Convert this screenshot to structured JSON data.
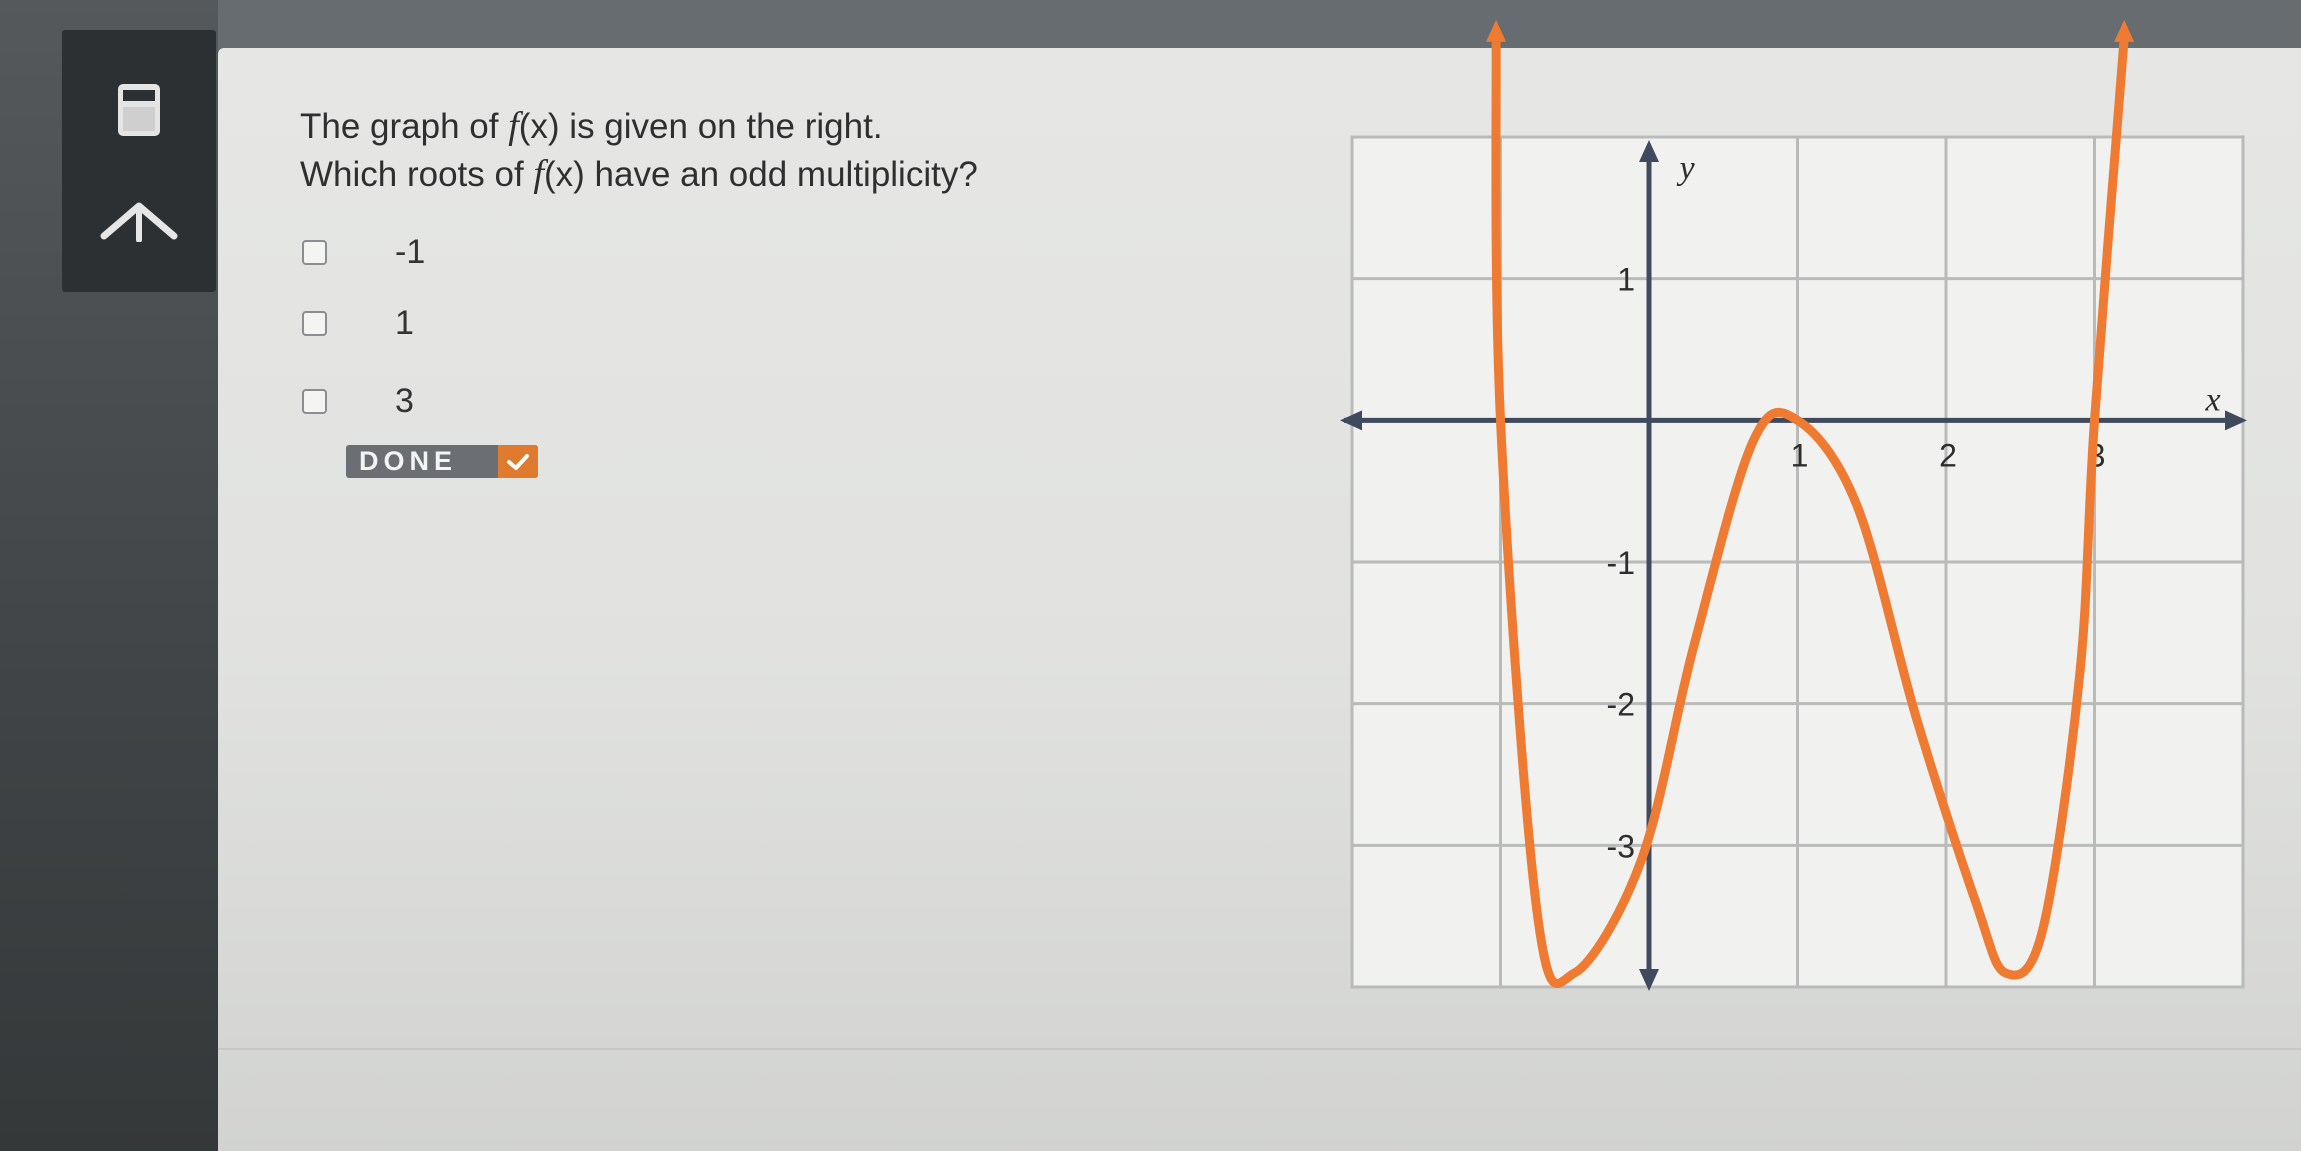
{
  "question": {
    "line1": {
      "prefix": "The graph of ",
      "func": "f",
      "arg": "(x)",
      "suffix": " is given on the right."
    },
    "line2": {
      "prefix": "Which roots of ",
      "func": "f",
      "arg": "(x)",
      "suffix": " have an odd multiplicity?"
    }
  },
  "options": [
    {
      "label": "-1",
      "checked": false
    },
    {
      "label": "1",
      "checked": false
    },
    {
      "label": "3",
      "checked": false
    }
  ],
  "done_button": {
    "label": "DONE"
  },
  "icons": {
    "calculator": "calculator-icon",
    "up_arrow": "up-arrow-icon",
    "done_check": "check-icon"
  },
  "colors": {
    "curve": "#ef7a31",
    "accent": "#e07a2e",
    "axis": "#3f4a5e",
    "grid": "#b9bbba",
    "graph_background": "#f1f1ef"
  },
  "graph": {
    "x_axis_name": "x",
    "y_axis_name": "y",
    "x_ticks": [
      {
        "value": -1,
        "label": "-"
      },
      {
        "value": 1,
        "label": "1"
      },
      {
        "value": 2,
        "label": "2"
      },
      {
        "value": 3,
        "label": "3"
      }
    ],
    "y_ticks": [
      {
        "value": 1,
        "label": "1"
      },
      {
        "value": -1,
        "label": "-1"
      },
      {
        "value": -2,
        "label": "-2"
      },
      {
        "value": -3,
        "label": "-3"
      }
    ],
    "x_range": [
      -2,
      4
    ],
    "y_range": [
      -4,
      2
    ],
    "grid": true,
    "curve_points": [
      [
        -1.03,
        2.7
      ],
      [
        -1,
        0
      ],
      [
        -0.75,
        -3.5
      ],
      [
        -0.5,
        -3.9
      ],
      [
        -0.05,
        -3.1
      ],
      [
        0.3,
        -1.6
      ],
      [
        0.7,
        -0.15
      ],
      [
        1,
        0
      ],
      [
        1.4,
        -0.6
      ],
      [
        1.8,
        -2.1
      ],
      [
        2.2,
        -3.4
      ],
      [
        2.4,
        -3.9
      ],
      [
        2.65,
        -3.6
      ],
      [
        2.9,
        -1.8
      ],
      [
        3,
        0
      ],
      [
        3.2,
        2.7
      ]
    ]
  }
}
